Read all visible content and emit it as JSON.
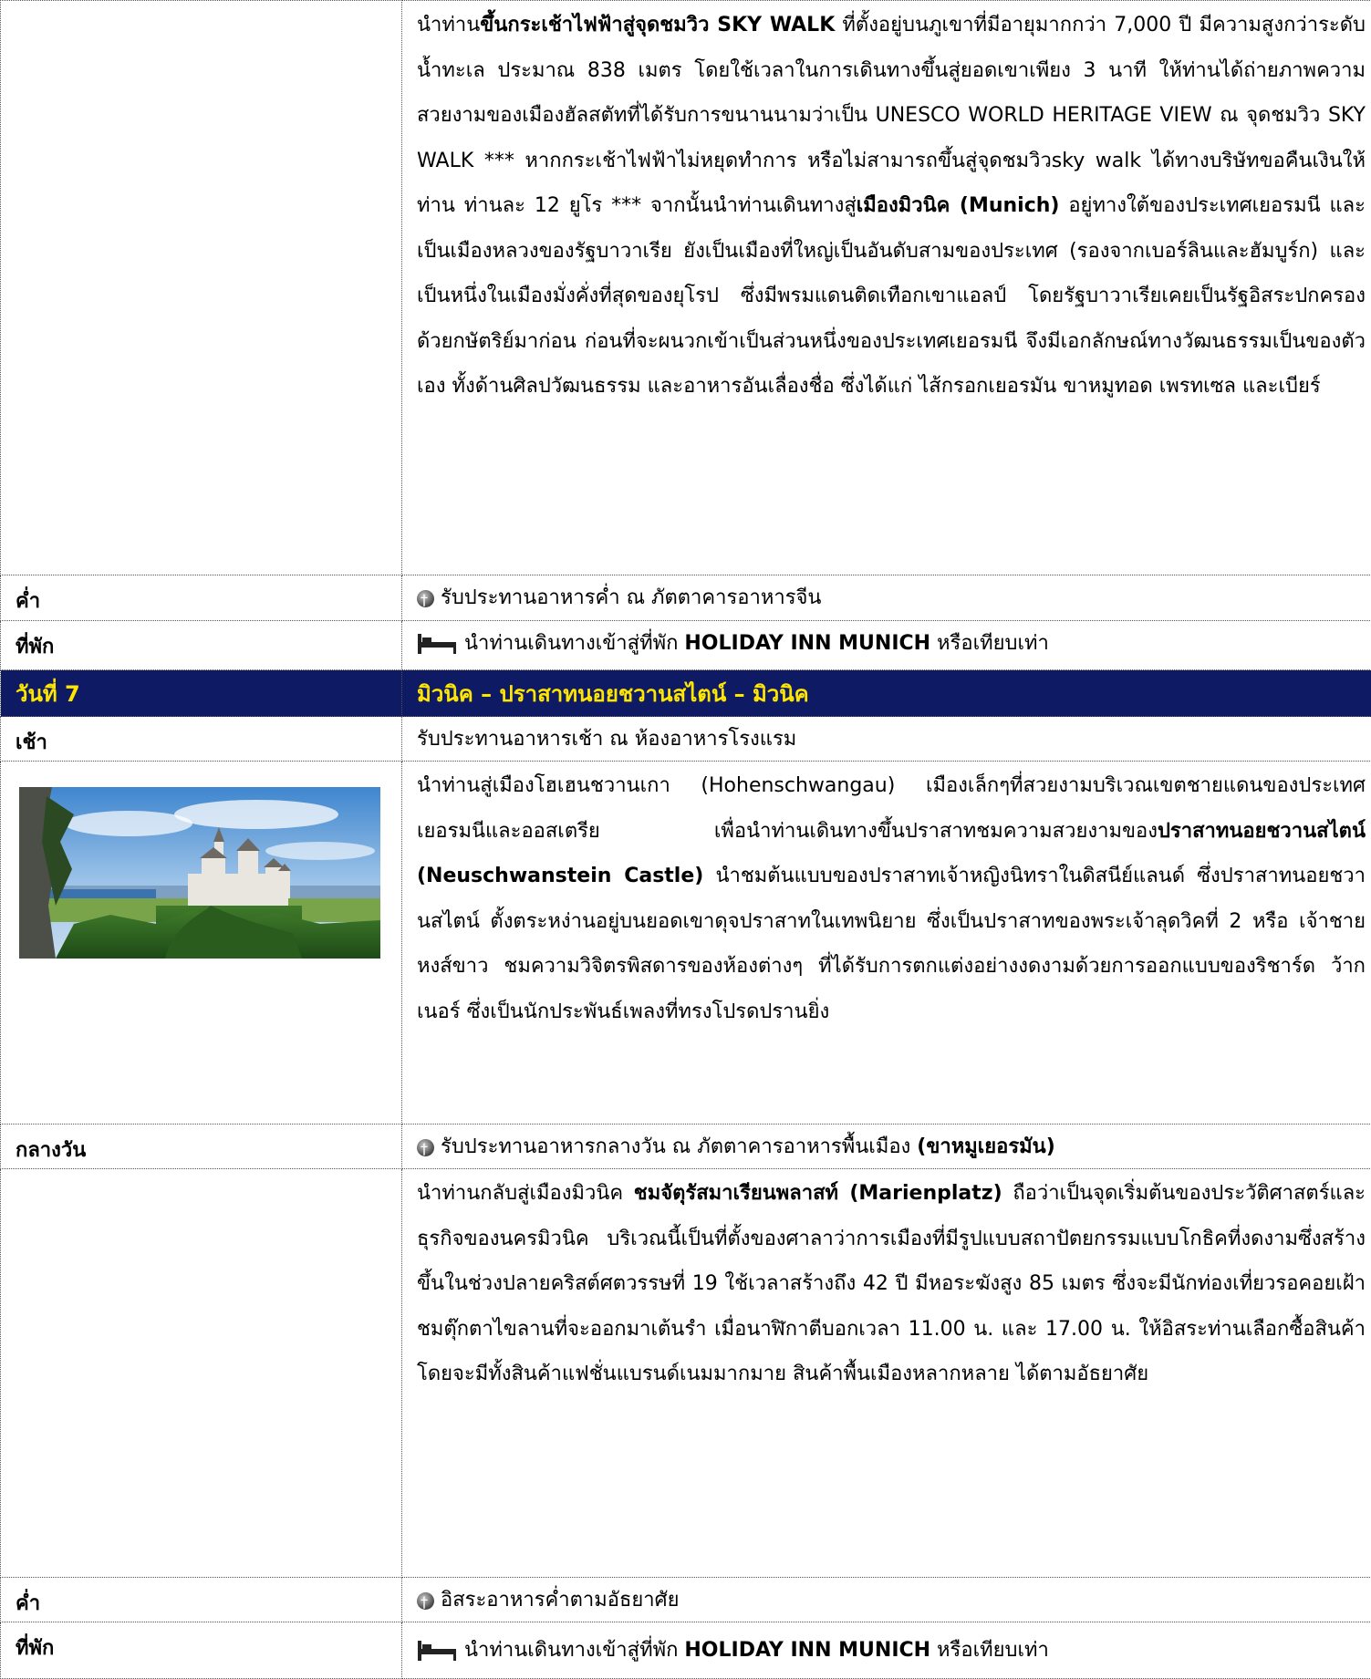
{
  "row1": {
    "label": "",
    "p": [
      "นำท่าน",
      "ขึ้นกระเช้าไฟฟ้าสู่จุดชมวิว SKY  WALK",
      "  ที่ตั้งอยู่บนภูเขาที่มีอายุมากกว่า 7,000 ปี มีความสูงกว่าระดับน้ำทะเล ประมาณ 838 เมตร โดยใช้เวลาในการเดินทางขึ้นสู่ยอดเขาเพียง 3 นาที ให้ท่านได้ถ่ายภาพความสวยงามของเมืองฮัลสตัทที่ได้รับการขนานนามว่าเป็น UNESCO WORLD HERITAGE VIEW ณ จุดชมวิว SKY WALK *** หากกระเช้าไฟฟ้าไม่หยุดทำการ หรือไม่สามารถขึ้นสู่จุดชมวิวsky walk ได้ทางบริษัทขอคืนเงินให้ท่าน ท่านละ 12 ยูโร *** จากนั้นนำท่านเดินทางสู่",
      "เมืองมิวนิค (Munich)",
      " อยู่ทางใต้ของประเทศเยอรมนี และเป็นเมืองหลวงของรัฐบาวาเรีย ยังเป็นเมืองที่ใหญ่เป็นอันดับสามของประเทศ (รองจากเบอร์ลินและฮัมบูร์ก) และเป็นหนึ่งในเมืองมั่งคั่งที่สุดของยุโรป ซึ่งมีพรมแดนติดเทือกเขาแอลป์  โดยรัฐบาวาเรียเคยเป็นรัฐอิสระปกครองด้วยกษัตริย์มาก่อน ก่อนที่จะผนวกเข้าเป็นส่วนหนึ่งของประเทศเยอรมนี จึงมีเอกลักษณ์ทางวัฒนธรรมเป็นของตัวเอง ทั้งด้านศิลปวัฒนธรรม และอาหารอันเลื่องชื่อ ซึ่งได้แก่ ไส้กรอกเยอรมัน ขาหมูทอด เพรทเซล และเบียร์"
    ]
  },
  "row2": {
    "label": "ค่ำ",
    "text": "รับประทานอาหารค่ำ ณ ภัตตาคารอาหารจีน"
  },
  "row3": {
    "label": "ที่พัก",
    "pre": "นำท่านเดินทางเข้าสู่ที่พัก ",
    "bold": "HOLIDAY INN MUNICH",
    "post": " หรือเทียบเท่า"
  },
  "day7": {
    "day": "วันที่ 7",
    "title": "มิวนิค – ปราสาทนอยชวานสไตน์ – มิวนิค"
  },
  "row5": {
    "label": "เช้า",
    "text": "รับประทานอาหารเช้า ณ ห้องอาหารโรงแรม"
  },
  "row6": {
    "p": [
      "นำท่านสู่เมืองโฮเฮนชวานเกา (Hohenschwangau)  เมืองเล็กๆที่สวยงามบริเวณเขตชายแดนของประเทศเยอรมนีและออสเตรีย เพื่อนำท่านเดินทางขึ้นปราสาทชมความสวยงามของ",
      "ปราสาทนอยชวานสไตน์ (Neuschwanstein Castle)",
      " นำชมต้นแบบของปราสาทเจ้าหญิงนิทราในดิสนีย์แลนด์ ซึ่งปราสาทนอยชวานสไตน์ ตั้งตระหง่านอยู่บนยอดเขาดุจปราสาทในเทพนิยาย ซึ่งเป็นปราสาทของพระเจ้าลุดวิคที่ 2 หรือ เจ้าชายหงส์ขาว  ชมความวิจิตรพิสดารของห้องต่างๆ ที่ได้รับการตกแต่งอย่างงดงามด้วยการออกแบบของริชาร์ด ว้ากเนอร์ ซึ่งเป็นนักประพันธ์เพลงที่ทรงโปรดปรานยิ่ง"
    ]
  },
  "row7": {
    "label": "กลางวัน",
    "pre": "รับประทานอาหารกลางวัน ณ ภัตตาคารอาหารพื้นเมือง ",
    "bold": "(ขาหมูเยอรมัน)"
  },
  "row8": {
    "p": [
      "นำท่านกลับสู่เมืองมิวนิค ",
      "ชมจัตุรัสมาเรียนพลาสท์ (Marienplatz)",
      "   ถือว่าเป็นจุดเริ่มต้นของประวัติศาสตร์และธุรกิจของนครมิวนิค บริเวณนี้เป็นที่ตั้งของศาลาว่าการเมืองที่มีรูปแบบสถาปัตยกรรมแบบโกธิคที่งดงามซึ่งสร้างขึ้นในช่วงปลายคริสต์ศตวรรษที่ 19 ใช้เวลาสร้างถึง 42 ปี มีหอระฆังสูง 85 เมตร ซึ่งจะมีนักท่องเที่ยวรอคอยเฝ้าชมตุ๊กตาไขลานที่จะออกมาเต้นรำ เมื่อนาฬิกาตีบอกเวลา 11.00 น. และ 17.00 น. ให้อิสระท่านเลือกซื้อสินค้า โดยจะมีทั้งสินค้าแฟชั่นแบรนด์เนมมากมาย สินค้าพื้นเมืองหลากหลาย ได้ตามอัธยาศัย"
    ]
  },
  "row9": {
    "label": "ค่ำ",
    "text": "อิสระอาหารค่ำตามอัธยาศัย"
  },
  "row10": {
    "label": "ที่พัก",
    "pre": "นำท่านเดินทางเข้าสู่ที่พัก ",
    "bold": "HOLIDAY INN MUNICH",
    "post": " หรือเทียบเท่า"
  },
  "icons": {
    "meal": "restaurant-icon",
    "hotel": "bed-icon"
  },
  "colors": {
    "header_bg": "#0e1a63",
    "header_text": "#ffe600"
  }
}
